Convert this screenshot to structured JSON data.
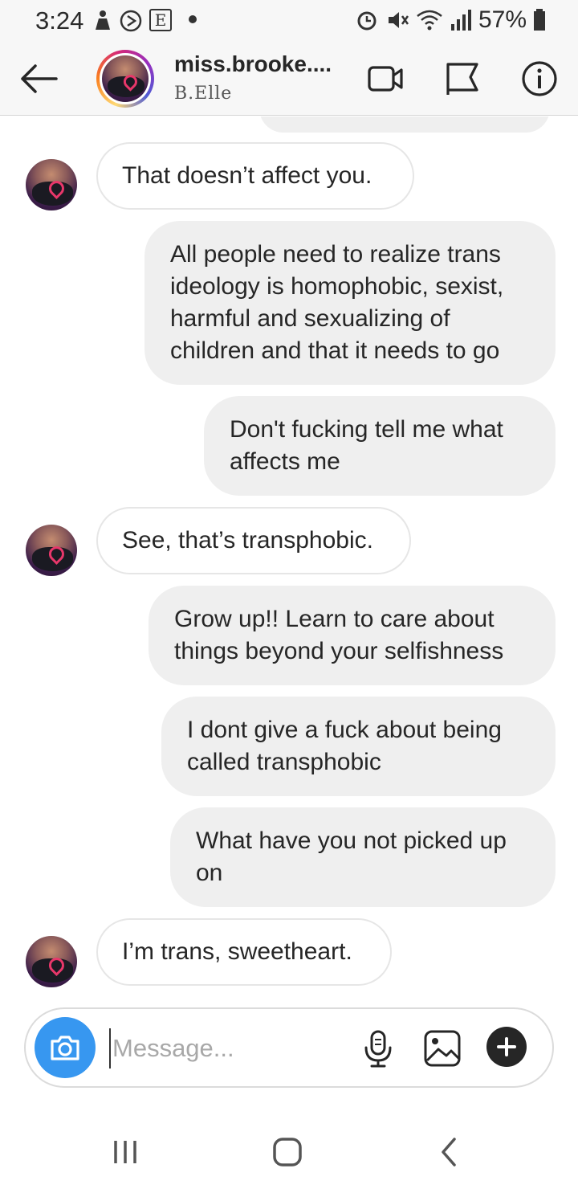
{
  "status_bar": {
    "time": "3:24",
    "battery_percent": "57%",
    "notif_e_label": "E"
  },
  "header": {
    "name": "miss.brooke....",
    "subtitle": "B.Elle"
  },
  "messages": [
    {
      "side": "in",
      "text": "That doesn’t affect you."
    },
    {
      "side": "out",
      "text": "All people need to realize trans ideology is homophobic, sexist, harmful and sexualizing of children and that it needs to go"
    },
    {
      "side": "out",
      "text": "Don't fucking tell me what affects me"
    },
    {
      "side": "in",
      "text": "See, that’s transphobic."
    },
    {
      "side": "out",
      "text": "Grow up!! Learn to care about things beyond your selfishness"
    },
    {
      "side": "out",
      "text": "I dont give a fuck about being called transphobic"
    },
    {
      "side": "out",
      "text": "What have you not picked up on"
    },
    {
      "side": "in",
      "text": "I’m trans, sweetheart."
    }
  ],
  "composer": {
    "placeholder": "Message..."
  },
  "icons": {
    "status": [
      "alarm-icon",
      "mute-icon",
      "wifi-icon",
      "signal-icon",
      "battery-icon"
    ],
    "header": [
      "back-arrow-icon",
      "video-call-icon",
      "flag-icon",
      "info-icon"
    ],
    "composer": [
      "camera-icon",
      "microphone-icon",
      "gallery-icon",
      "plus-icon"
    ],
    "navigation": [
      "recent-apps-icon",
      "home-icon",
      "back-nav-icon"
    ]
  },
  "colors": {
    "accent_blue": "#3797f0",
    "incoming_bubble": "#ffffff",
    "outgoing_bubble": "#efefef",
    "text": "#262626"
  }
}
